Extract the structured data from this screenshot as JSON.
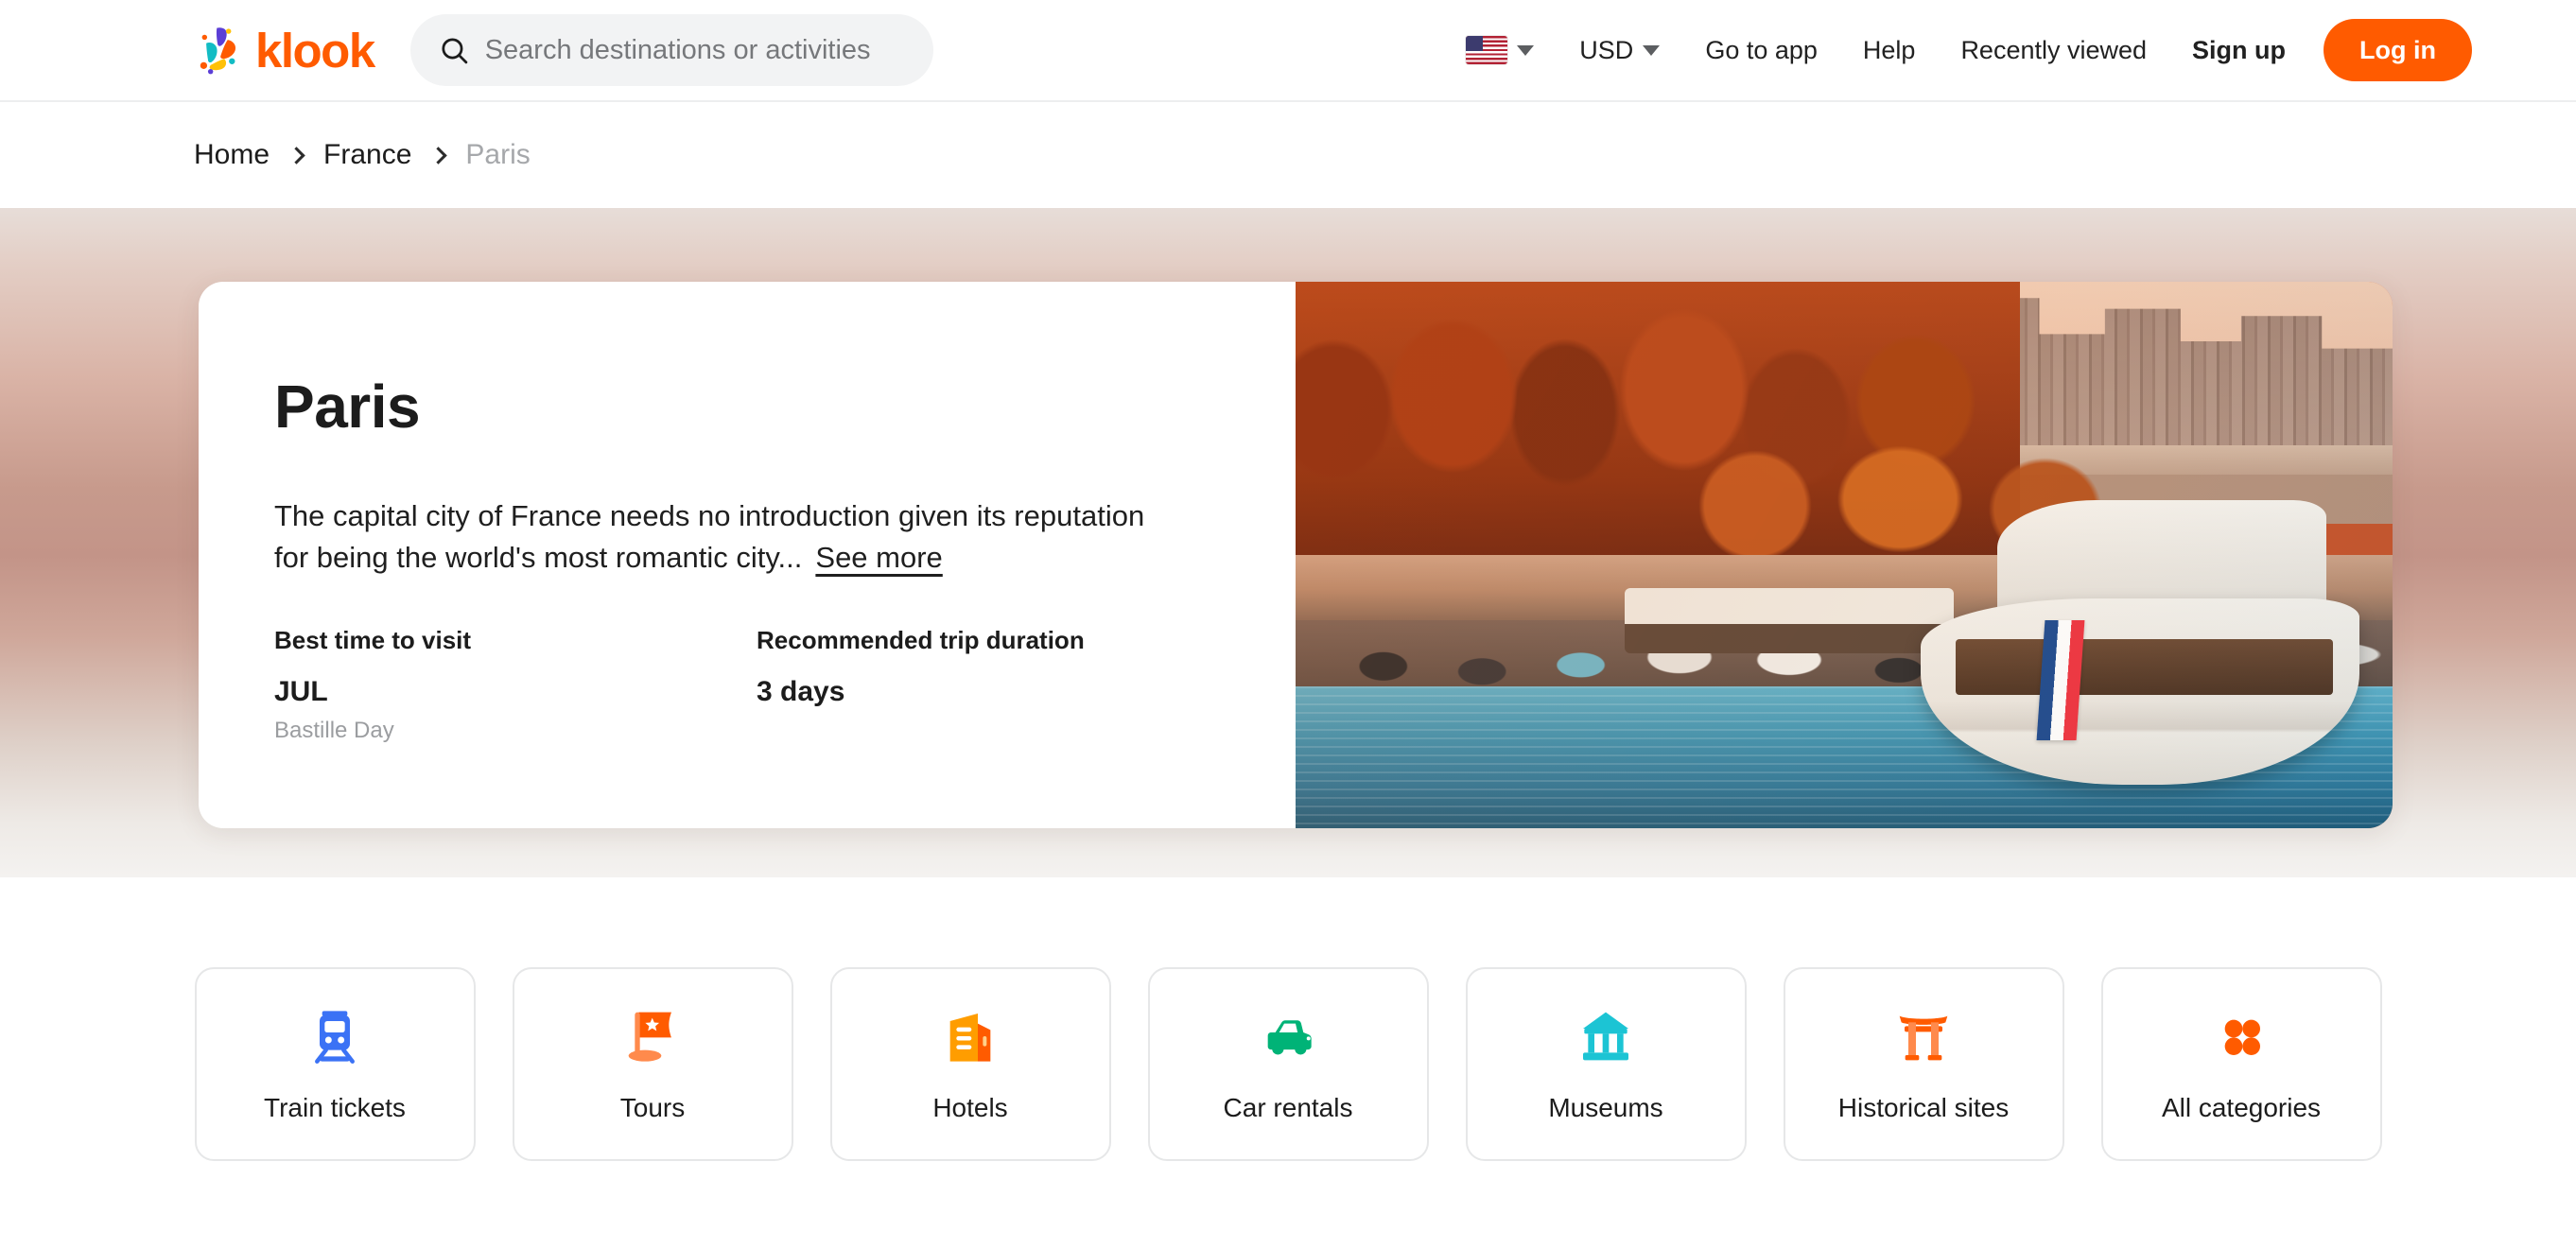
{
  "brand": {
    "name": "klook",
    "logo_icon": "klook-pinwheel-logo",
    "accent_color": "#ff5b00"
  },
  "header": {
    "search": {
      "icon": "search-icon",
      "placeholder": "Search destinations or activities",
      "value": ""
    },
    "language": {
      "icon": "us-flag-icon",
      "caret": "chevron-down-icon"
    },
    "currency": {
      "label": "USD",
      "caret": "chevron-down-icon"
    },
    "links": [
      {
        "label": "Go to app",
        "name": "go-to-app"
      },
      {
        "label": "Help",
        "name": "help"
      },
      {
        "label": "Recently viewed",
        "name": "recently-viewed"
      }
    ],
    "signup_label": "Sign up",
    "login_label": "Log in"
  },
  "breadcrumb": {
    "separator_icon": "chevron-right-icon",
    "items": [
      {
        "label": "Home",
        "current": false
      },
      {
        "label": "France",
        "current": false
      },
      {
        "label": "Paris",
        "current": true
      }
    ]
  },
  "hero": {
    "title": "Paris",
    "description": "The capital city of France needs no introduction given its reputation for being the world's most romantic city...",
    "see_more_label": "See more",
    "facts": [
      {
        "label": "Best time to visit",
        "value": "JUL",
        "sub": "Bastille Day"
      },
      {
        "label": "Recommended trip duration",
        "value": "3 days",
        "sub": ""
      }
    ],
    "photo_alt": "Seine riverside in Paris at sunset with a cruise boat flying the French flag"
  },
  "categories": [
    {
      "label": "Train tickets",
      "icon": "train-icon",
      "color": "#3b72f5"
    },
    {
      "label": "Tours",
      "icon": "flag-star-icon",
      "color": "#ff5b00"
    },
    {
      "label": "Hotels",
      "icon": "hotel-building-icon",
      "color": "#ff9d00"
    },
    {
      "label": "Car rentals",
      "icon": "car-icon",
      "color": "#00b377"
    },
    {
      "label": "Museums",
      "icon": "museum-icon",
      "color": "#1cc4d4"
    },
    {
      "label": "Historical sites",
      "icon": "torii-gate-icon",
      "color": "#ff7a3d"
    },
    {
      "label": "All categories",
      "icon": "grid-dots-icon",
      "color": "#ff5b00"
    }
  ]
}
